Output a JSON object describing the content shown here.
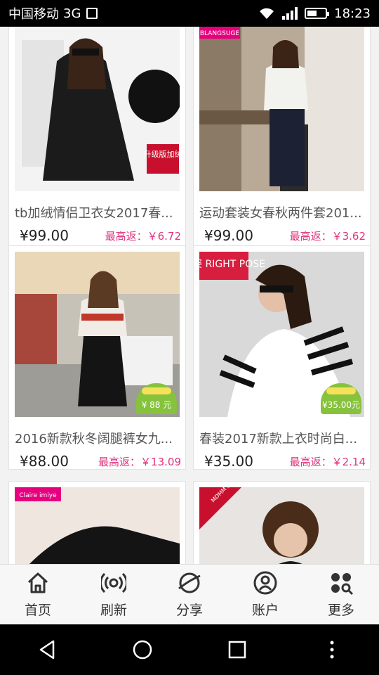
{
  "status_bar": {
    "carrier": "中国移动",
    "network": "3G",
    "signal_label": "3G",
    "time": "18:23",
    "battery_level": 0.55
  },
  "products": [
    {
      "title": "tb加绒情侣卫衣女2017春...",
      "price": "¥99.00",
      "rebate": "最高返：￥6.72",
      "image": "black-hoodie-photo",
      "banner": "升级版加绒"
    },
    {
      "title": "运动套装女春秋两件套201...",
      "price": "¥99.00",
      "rebate": "最高返：￥3.62",
      "image": "white-sweatshirt-set-photo",
      "banner": "BLANGSUGE"
    },
    {
      "title": "2016新款秋冬阔腿裤女九...",
      "price": "¥88.00",
      "rebate": "最高返：￥13.09",
      "image": "street-outfit-photo",
      "badge": "¥ 88 元"
    },
    {
      "title": "春装2017新款上衣时尚白...",
      "price": "¥35.00",
      "rebate": "最高返：￥2.14",
      "image": "striped-tee-photo",
      "banner": "右姿 RIGHT POSE",
      "badge": "¥35.00元"
    },
    {
      "title": "",
      "price": "",
      "rebate": "",
      "image": "black-leggings-photo",
      "banner": "Claire imiye"
    },
    {
      "title": "",
      "price": "",
      "rebate": "",
      "image": "lace-top-photo",
      "banner": "MDMM 魔登美眉"
    }
  ],
  "tabs": [
    {
      "label": "首页",
      "icon": "home-icon"
    },
    {
      "label": "刷新",
      "icon": "broadcast-icon"
    },
    {
      "label": "分享",
      "icon": "planet-icon"
    },
    {
      "label": "账户",
      "icon": "account-icon"
    },
    {
      "label": "更多",
      "icon": "grid-search-icon"
    }
  ],
  "colors": {
    "rebate": "#e0327e",
    "accent_badge": "#86c23b",
    "banner_red": "#d81e3e",
    "banner_magenta": "#e6007e"
  }
}
